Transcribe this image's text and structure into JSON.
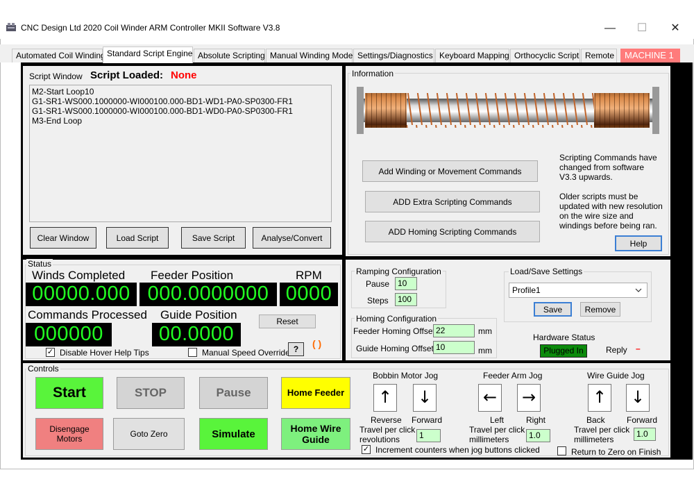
{
  "window": {
    "title": "CNC Design Ltd 2020 Coil Winder ARM Controller MKII Software V3.8",
    "minimize_glyph": "—",
    "maximize_glyph": "☐",
    "close_glyph": "✕"
  },
  "tabs": [
    {
      "label": "Automated Coil Winding",
      "active": false
    },
    {
      "label": "Standard Script Engine",
      "active": true
    },
    {
      "label": "Absolute Scripting",
      "active": false
    },
    {
      "label": "Manual Winding Mode",
      "active": false
    },
    {
      "label": "Settings/Diagnostics",
      "active": false
    },
    {
      "label": "Keyboard Mapping",
      "active": false
    },
    {
      "label": "Orthocyclic Script",
      "active": false
    },
    {
      "label": "Remote",
      "active": false
    },
    {
      "label": "MACHINE 1",
      "active": false
    }
  ],
  "script": {
    "window_label": "Script Window",
    "loaded_label": "Script Loaded:",
    "loaded_value": "None",
    "lines": [
      "M2-Start Loop10",
      "G1-SR1-WS000.1000000-WI000100.000-BD1-WD1-PA0-SP0300-FR1",
      "G1-SR1-WS000.1000000-WI000100.000-BD1-WD0-PA0-SP0300-FR1",
      "M3-End Loop"
    ],
    "clear_button": "Clear Window",
    "load_button": "Load Script",
    "save_button": "Save Script",
    "analyse_button": "Analyse/Convert"
  },
  "information": {
    "label": "Information",
    "add_winding_button": "Add Winding or Movement Commands",
    "add_extra_button": "ADD Extra Scripting Commands",
    "add_homing_button": "ADD Homing Scripting Commands",
    "note1": "Scripting Commands have changed from software V3.3 upwards.",
    "note2": "Older scripts must be updated with new resolution on the wire size and windings before being ran.",
    "help_button": "Help"
  },
  "status": {
    "label": "Status",
    "winds_label": "Winds Completed",
    "winds_value": "00000.000",
    "feeder_label": "Feeder Position",
    "feeder_value": "000.0000000",
    "rpm_label": "RPM",
    "rpm_value": "0000",
    "commands_label": "Commands Processed",
    "commands_value": "000000",
    "guide_label": "Guide Position",
    "guide_value": "00.0000",
    "reset_button": "Reset",
    "disable_hover_label": "Disable Hover Help Tips",
    "disable_hover_checked": true,
    "manual_speed_label": "Manual Speed Override",
    "manual_speed_checked": false,
    "question_button": "?",
    "paren_indicator": "( )"
  },
  "ramping": {
    "label": "Ramping Configuration",
    "pause_label": "Pause",
    "pause_value": "10",
    "steps_label": "Steps",
    "steps_value": "100"
  },
  "homing": {
    "label": "Homing Configuration",
    "feeder_offset_label": "Feeder Homing Offset",
    "feeder_offset_value": "22",
    "feeder_unit": "mm",
    "guide_offset_label": "Guide Homing Offset",
    "guide_offset_value": "10",
    "guide_unit": "mm"
  },
  "loadsave": {
    "label": "Load/Save Settings",
    "profile_value": "Profile1",
    "save_button": "Save",
    "remove_button": "Remove",
    "hardware_status_label": "Hardware Status",
    "hardware_status_value": "Plugged In",
    "reply_label": "Reply",
    "reply_value": "–"
  },
  "controls": {
    "label": "Controls",
    "start_button": "Start",
    "stop_button": "STOP",
    "pause_button": "Pause",
    "home_feeder_button": "Home Feeder",
    "disengage_button": "Disengage Motors",
    "goto_zero_button": "Goto Zero",
    "simulate_button": "Simulate",
    "home_guide_button": "Home Wire Guide"
  },
  "jog": {
    "bobbin_label": "Bobbin Motor Jog",
    "bobbin_left_label": "Reverse",
    "bobbin_right_label": "Forward",
    "bobbin_travel_label": "Travel per click revolutions",
    "bobbin_travel_value": "1",
    "feeder_label": "Feeder Arm Jog",
    "feeder_left_label": "Left",
    "feeder_right_label": "Right",
    "feeder_travel_label": "Travel per click millimeters",
    "feeder_travel_value": "1.0",
    "guide_label": "Wire Guide Jog",
    "guide_left_label": "Back",
    "guide_right_label": "Forward",
    "guide_travel_label": "Travel per click millimeters",
    "guide_travel_value": "1.0",
    "increment_label": "Increment counters when jog buttons clicked",
    "increment_checked": true,
    "return_zero_label": "Return to Zero on Finish",
    "return_zero_checked": false
  },
  "colors": {
    "led_text": "#22ff22",
    "start_green": "#59f43b",
    "home_yellow": "#ffff00",
    "disengage_red": "#f08080",
    "machine_tab": "#ff7b7b",
    "script_loaded_none": "#ff0000",
    "input_bg": "#ccffcc"
  }
}
